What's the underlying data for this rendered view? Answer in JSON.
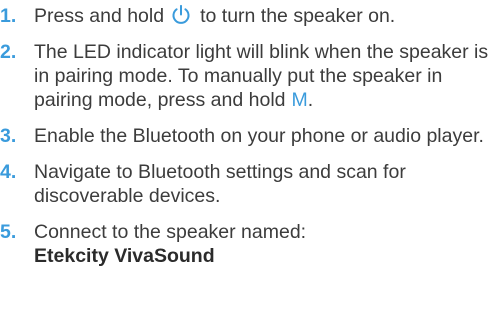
{
  "colors": {
    "accent": "#3a9bdc",
    "text": "#3c3c3c"
  },
  "steps": [
    {
      "number": "1.",
      "text_before": "Press and hold",
      "icon": "power-icon",
      "text_after": "to turn the speaker on."
    },
    {
      "number": "2.",
      "text_before": "The LED indicator light will blink when the speaker is in pairing mode. To manually put the speaker in pairing mode, press and hold",
      "key": "M",
      "text_after": "."
    },
    {
      "number": "3.",
      "text": "Enable the Bluetooth on your phone or audio player."
    },
    {
      "number": "4.",
      "text": "Navigate to Bluetooth settings and scan for discoverable devices."
    },
    {
      "number": "5.",
      "text": "Connect to the speaker named:",
      "name": "Etekcity VivaSound"
    }
  ]
}
